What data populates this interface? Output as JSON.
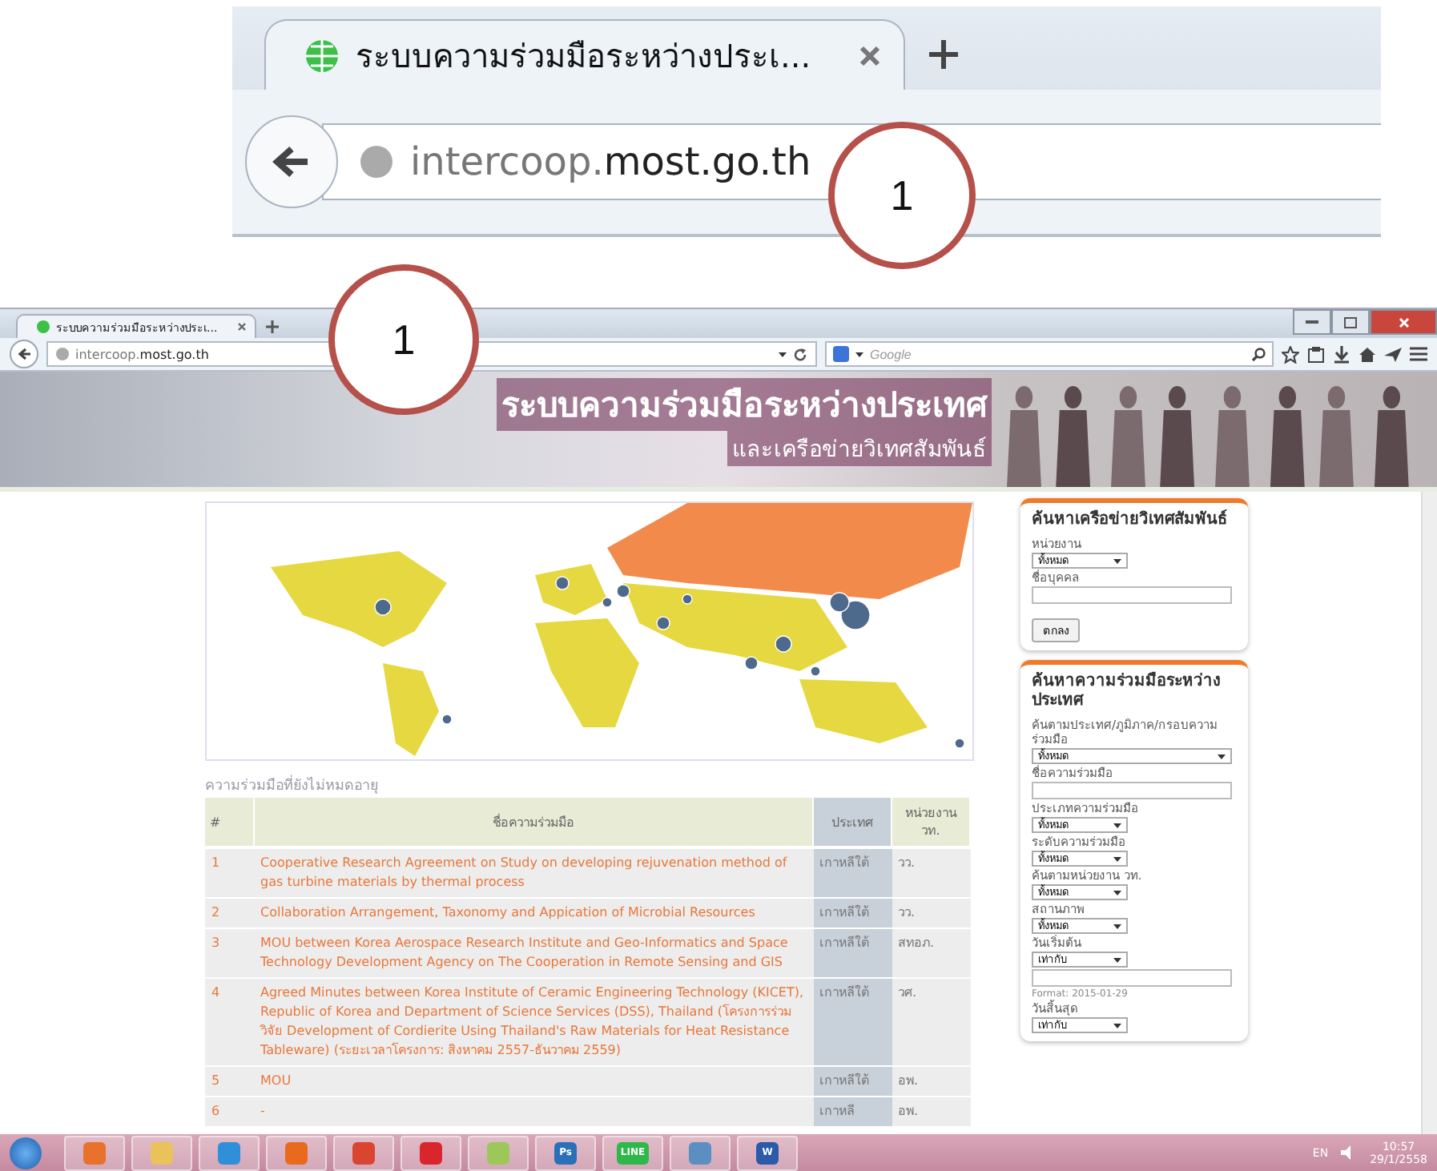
{
  "zoomed_view": {
    "tab_title": "ระบบความร่วมมือระหว่างประเ...",
    "url": "intercoop.**most.go.th**",
    "callout": "1"
  },
  "browser": {
    "tab_title": "ระบบความร่วมมือระหว่างประเ...",
    "url": "intercoop.**most.go.th**",
    "search_placeholder": "Google",
    "callout": "1"
  },
  "banner": {
    "title": "ระบบความร่วมมือระหว่างประเทศ",
    "subtitle": "และเครือข่ายวิเทศสัมพันธ์"
  },
  "table": {
    "caption": "ความร่วมมือที่ยังไม่หมดอายุ",
    "columns": [
      "#",
      "ชื่อความร่วมมือ",
      "ประเทศ",
      "หน่วยงาน วท."
    ],
    "rows": [
      {
        "cells": [
          "1",
          "Cooperative Research Agreement on Study on developing rejuvenation method of gas turbine materials by thermal process",
          "เกาหลีใต้",
          "วว."
        ]
      },
      {
        "cells": [
          "2",
          "Collaboration Arrangement, Taxonomy and Appication of Microbial Resources",
          "เกาหลีใต้",
          "วว."
        ]
      },
      {
        "cells": [
          "3",
          "MOU between Korea Aerospace Research Institute and Geo-Informatics and Space Technology Development Agency on The Cooperation in Remote Sensing and GIS",
          "เกาหลีใต้",
          "สทอภ."
        ]
      },
      {
        "cells": [
          "4",
          "Agreed Minutes between Korea Institute of Ceramic Engineering Technology (KICET), Republic of Korea and Department of Science Services (DSS), Thailand (โครงการร่วมวิจัย Development of Cordierite Using Thailand's Raw Materials for Heat Resistance Tableware) (ระยะเวลาโครงการ: สิงหาคม 2557-ธันวาคม 2559)",
          "เกาหลีใต้",
          "วศ."
        ]
      },
      {
        "cells": [
          "5",
          "MOU",
          "เกาหลีใต้",
          "อพ."
        ]
      },
      {
        "cells": [
          "6",
          "-",
          "เกาหลี",
          "อพ."
        ]
      }
    ]
  },
  "sidebar": {
    "panels": [
      {
        "title": "ค้นหาเครือข่ายวิเทศสัมพันธ์",
        "button": "ตกลง",
        "fields": [
          {
            "kind": "label",
            "text": "หน่วยงาน"
          },
          {
            "kind": "select",
            "text": "ทั้งหมด"
          },
          {
            "kind": "label",
            "text": "ชื่อบุคคล"
          },
          {
            "kind": "input"
          }
        ]
      },
      {
        "title": "ค้นหาความร่วมมือระหว่างประเทศ",
        "fields": [
          {
            "kind": "label",
            "text": "ค้นตามประเทศ/ภูมิภาค/กรอบความร่วมมือ"
          },
          {
            "kind": "select",
            "text": "ทั้งหมด",
            "wide": true
          },
          {
            "kind": "label",
            "text": "ชื่อความร่วมมือ"
          },
          {
            "kind": "input"
          },
          {
            "kind": "label",
            "text": "ประเภทความร่วมมือ"
          },
          {
            "kind": "select",
            "text": "ทั้งหมด"
          },
          {
            "kind": "label",
            "text": "ระดับความร่วมมือ"
          },
          {
            "kind": "select",
            "text": "ทั้งหมด"
          },
          {
            "kind": "label",
            "text": "ค้นตามหน่วยงาน วท."
          },
          {
            "kind": "select",
            "text": "ทั้งหมด"
          },
          {
            "kind": "label",
            "text": "สถานภาพ"
          },
          {
            "kind": "select",
            "text": "ทั้งหมด"
          },
          {
            "kind": "label",
            "text": "วันเริ่มต้น"
          },
          {
            "kind": "select",
            "text": "เท่ากับ"
          },
          {
            "kind": "input"
          },
          {
            "kind": "note",
            "text": "Format: 2015-01-29"
          },
          {
            "kind": "label",
            "text": "วันสิ้นสุด"
          },
          {
            "kind": "select",
            "text": "เท่ากับ"
          }
        ]
      }
    ]
  },
  "taskbar": {
    "apps": [
      {
        "color": "#e8722c"
      },
      {
        "color": "#e9c25a"
      },
      {
        "color": "#2f8fd8"
      },
      {
        "color": "#e86a1e"
      },
      {
        "color": "#d9452f"
      },
      {
        "color": "#d8262c"
      },
      {
        "color": "#9cc85a"
      },
      {
        "color": "#2a70b8",
        "label": "Ps"
      },
      {
        "color": "#2fb84a",
        "label": "LINE"
      },
      {
        "color": "#5b8fc2"
      },
      {
        "color": "#2a5aa8",
        "label": "W"
      }
    ],
    "language": "EN",
    "time": "10:57",
    "date": "29/1/2558"
  }
}
